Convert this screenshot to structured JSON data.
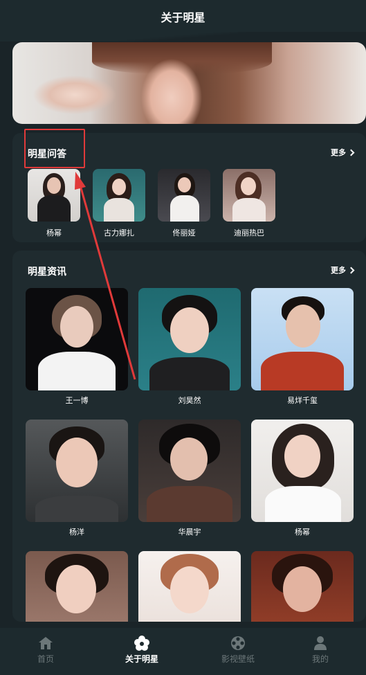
{
  "header": {
    "title": "关于明星"
  },
  "qa": {
    "title": "明星问答",
    "more": "更多",
    "items": [
      {
        "name": "杨幂"
      },
      {
        "name": "古力娜扎"
      },
      {
        "name": "佟丽娅"
      },
      {
        "name": "迪丽热巴"
      }
    ]
  },
  "news": {
    "title": "明星资讯",
    "more": "更多",
    "items": [
      {
        "name": "王一博"
      },
      {
        "name": "刘昊然"
      },
      {
        "name": "易烊千玺"
      },
      {
        "name": "杨洋"
      },
      {
        "name": "华晨宇"
      },
      {
        "name": "杨幂"
      },
      {
        "name": ""
      },
      {
        "name": ""
      },
      {
        "name": ""
      }
    ]
  },
  "tabbar": {
    "tabs": [
      {
        "label": "首页",
        "icon": "home-icon"
      },
      {
        "label": "关于明星",
        "icon": "star-flower-icon"
      },
      {
        "label": "影视壁纸",
        "icon": "film-reel-icon"
      },
      {
        "label": "我的",
        "icon": "user-icon"
      }
    ],
    "active_index": 1
  },
  "colors": {
    "background": "#1a2428",
    "card": "#1f2b2f",
    "highlight": "#e03a3a",
    "tab_inactive": "#6c7779"
  }
}
